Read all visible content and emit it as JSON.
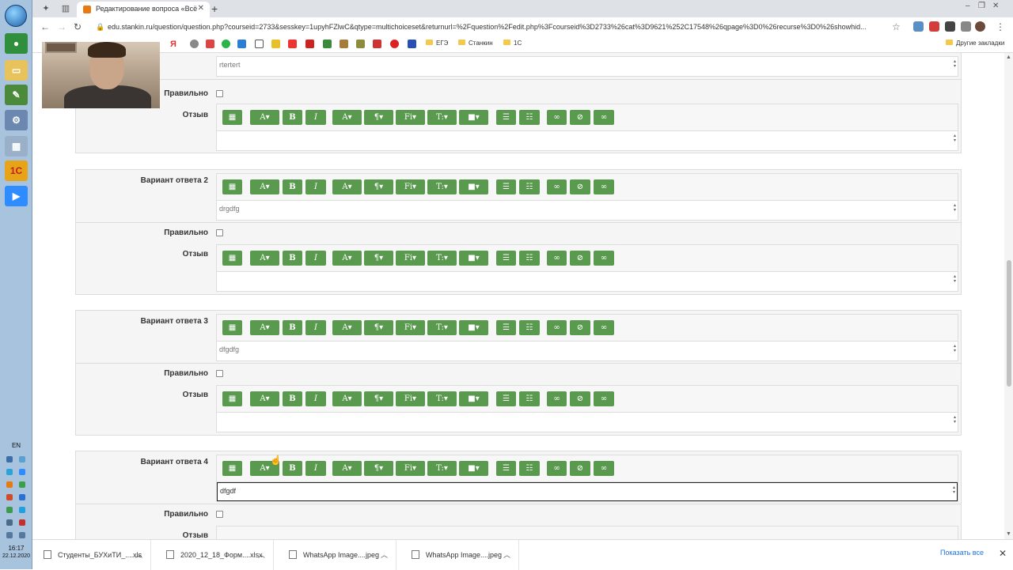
{
  "browser": {
    "tab_title": "Редактирование вопроса «Всё",
    "url": "edu.stankin.ru/question/question.php?courseid=2733&sesskey=1upyhFZlwC&qtype=multichoiceset&returnurl=%2Fquestion%2Fedit.php%3Fcourseid%3D2733%26cat%3D9621%252C17548%26qpage%3D0%26recurse%3D0%26showhid...",
    "bookmarks": [
      "ЕГЭ",
      "Станкин",
      "1С"
    ],
    "other_bookmarks": "Другие закладки"
  },
  "taskbar": {
    "lang": "EN",
    "time": "16:17",
    "date": "22.12.2020"
  },
  "form": {
    "answer1_text": "rtertert",
    "correct_label": "Правильно",
    "feedback_label": "Отзыв",
    "answers": [
      {
        "label": "Вариант ответа 2",
        "text": "drgdfg"
      },
      {
        "label": "Вариант ответа 3",
        "text": "dfgdfg"
      },
      {
        "label": "Вариант ответа 4",
        "text": "dfgdf"
      }
    ]
  },
  "toolbar_glyphs": {
    "bold": "B",
    "italic": "I",
    "font": "A",
    "style": "Fi",
    "text": "T:",
    "caret": "▾"
  },
  "downloads": {
    "items": [
      "Студенты_БУХиТИ_....xls",
      "2020_12_18_Форм....xlsx",
      "WhatsApp Image....jpeg",
      "WhatsApp Image....jpeg"
    ],
    "show_all": "Показать все"
  }
}
